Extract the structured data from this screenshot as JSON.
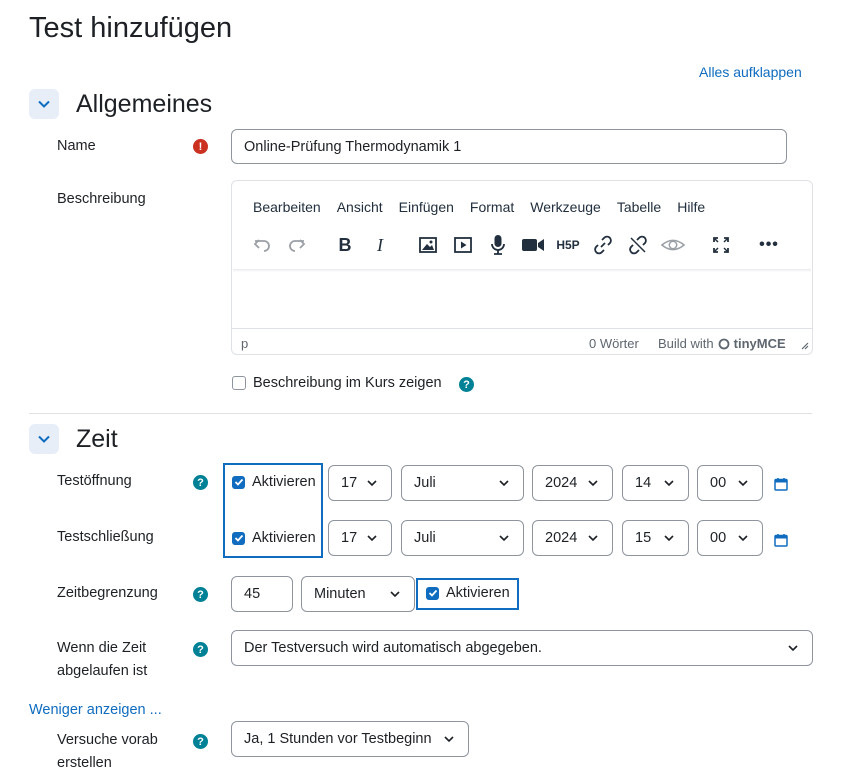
{
  "page_title": "Test hinzufügen",
  "expand_all": "Alles aufklappen",
  "general": {
    "title": "Allgemeines",
    "name_label": "Name",
    "name_value": "Online-Prüfung Thermodynamik 1",
    "description_label": "Beschreibung",
    "editor": {
      "menu": [
        "Bearbeiten",
        "Ansicht",
        "Einfügen",
        "Format",
        "Werkzeuge",
        "Tabelle",
        "Hilfe"
      ],
      "path": "p",
      "word_count": "0 Wörter",
      "build_with": "Build with",
      "brand": "tinyMCE"
    },
    "show_description_label": "Beschreibung im Kurs zeigen"
  },
  "timing": {
    "title": "Zeit",
    "open_label": "Testöffnung",
    "close_label": "Testschließung",
    "enable_label": "Aktivieren",
    "open": {
      "day": "17",
      "month": "Juli",
      "year": "2024",
      "hour": "14",
      "minute": "00"
    },
    "close": {
      "day": "17",
      "month": "Juli",
      "year": "2024",
      "hour": "15",
      "minute": "00"
    },
    "limit_label": "Zeitbegrenzung",
    "limit_value": "45",
    "limit_unit": "Minuten",
    "overdue_label_1": "Wenn die Zeit",
    "overdue_label_2": "abgelaufen ist",
    "overdue_value": "Der Testversuch wird automatisch abgegeben.",
    "show_less": "Weniger anzeigen ...",
    "precreate_label_1": "Versuche vorab",
    "precreate_label_2": "erstellen",
    "precreate_value": "Ja, 1 Stunden vor Testbeginn"
  },
  "colors": {
    "accent": "#0f6cbf",
    "help": "#008196",
    "required": "#ca3120"
  }
}
